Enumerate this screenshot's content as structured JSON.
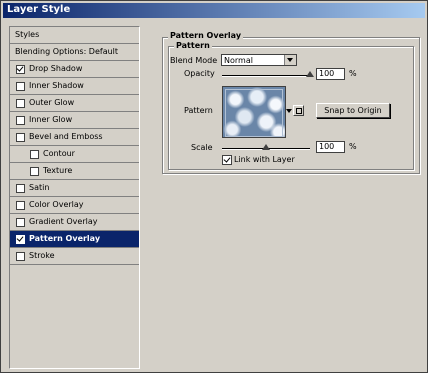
{
  "window": {
    "title": "Layer Style"
  },
  "style_list": [
    {
      "label": "Styles",
      "checkbox": false,
      "checked": false,
      "active": false,
      "sub": false
    },
    {
      "label": "Blending Options: Default",
      "checkbox": false,
      "checked": false,
      "active": false,
      "sub": false
    },
    {
      "label": "Drop Shadow",
      "checkbox": true,
      "checked": true,
      "active": false,
      "sub": false
    },
    {
      "label": "Inner Shadow",
      "checkbox": true,
      "checked": false,
      "active": false,
      "sub": false
    },
    {
      "label": "Outer Glow",
      "checkbox": true,
      "checked": false,
      "active": false,
      "sub": false
    },
    {
      "label": "Inner Glow",
      "checkbox": true,
      "checked": false,
      "active": false,
      "sub": false
    },
    {
      "label": "Bevel and Emboss",
      "checkbox": true,
      "checked": false,
      "active": false,
      "sub": false
    },
    {
      "label": "Contour",
      "checkbox": true,
      "checked": false,
      "active": false,
      "sub": true
    },
    {
      "label": "Texture",
      "checkbox": true,
      "checked": false,
      "active": false,
      "sub": true
    },
    {
      "label": "Satin",
      "checkbox": true,
      "checked": false,
      "active": false,
      "sub": false
    },
    {
      "label": "Color Overlay",
      "checkbox": true,
      "checked": false,
      "active": false,
      "sub": false
    },
    {
      "label": "Gradient Overlay",
      "checkbox": true,
      "checked": false,
      "active": false,
      "sub": false
    },
    {
      "label": "Pattern Overlay",
      "checkbox": true,
      "checked": true,
      "active": true,
      "sub": false
    },
    {
      "label": "Stroke",
      "checkbox": true,
      "checked": false,
      "active": false,
      "sub": false
    }
  ],
  "panel": {
    "group_title": "Pattern Overlay",
    "subgroup_title": "Pattern",
    "blend_mode_label": "Blend Mode",
    "blend_mode_value": "Normal",
    "opacity_label": "Opacity",
    "opacity_value": "100",
    "opacity_unit": "%",
    "opacity_level": 1.0,
    "pattern_label": "Pattern",
    "snap_button": "Snap to Origin",
    "scale_label": "Scale",
    "scale_value": "100",
    "scale_unit": "%",
    "scale_level": 0.5,
    "link_label": "Link with Layer",
    "link_checked": true
  },
  "colors": {
    "title_bar_start": "#0a246a",
    "title_bar_end": "#a6caf0",
    "selection": "#0a246a",
    "face": "#d4d0c8"
  }
}
